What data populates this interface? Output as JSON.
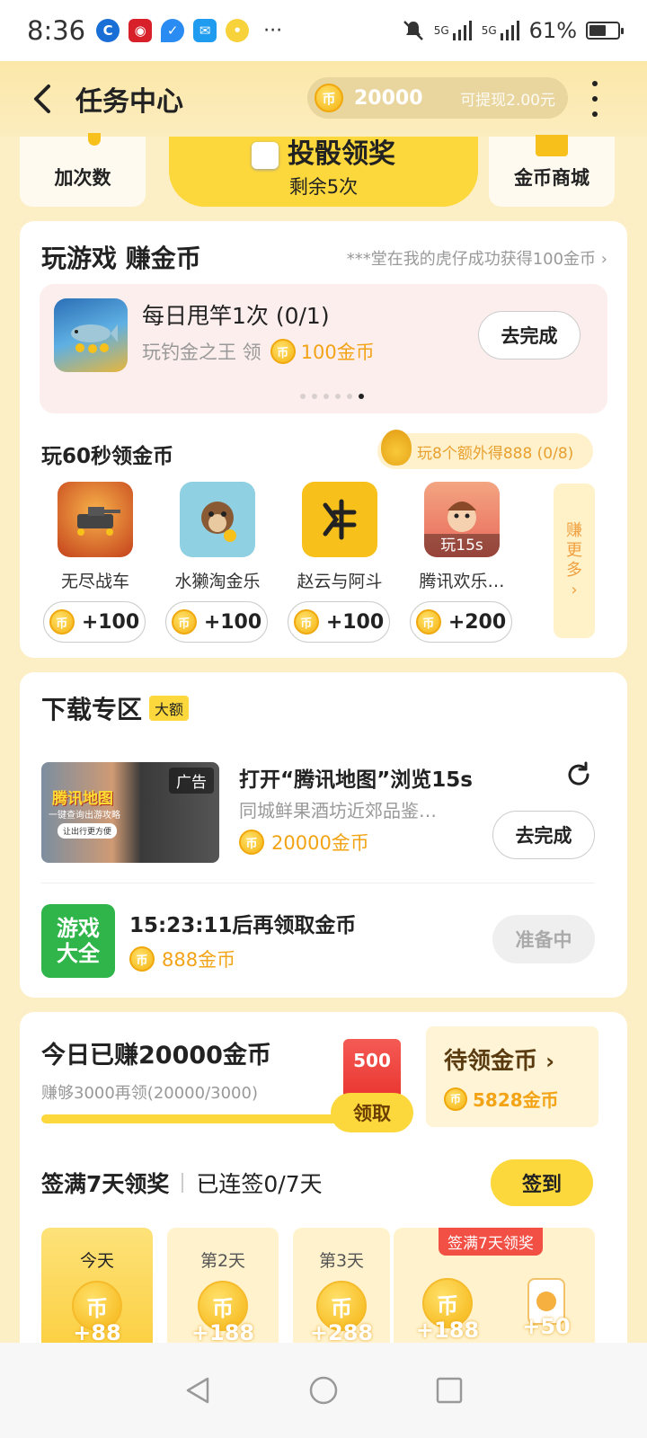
{
  "status_bar": {
    "time": "8:36",
    "more": "···",
    "network": "5G",
    "network2": "5G",
    "battery": "61%"
  },
  "header": {
    "title": "任务中心",
    "coin_balance": "20000",
    "withdraw_text": "可提现2.00元"
  },
  "top_cards": {
    "left_label": "加次数",
    "center_title": "投骰领奖",
    "center_sub": "剩余5次",
    "right_label": "金币商城"
  },
  "play_games": {
    "title": "玩游戏 赚金币",
    "ticker": "***堂在我的虎仔成功获得100金币",
    "task": {
      "name": "每日甩竿1次 (0/1)",
      "game": "玩钓金之王 领",
      "reward": "100金币",
      "button": "去完成"
    },
    "carousel_count": 6,
    "carousel_active": 5
  },
  "sixty_sec": {
    "title": "玩60秒领金币",
    "bonus": "玩8个额外得888 (0/8)",
    "games": [
      {
        "name": "无尽战车",
        "reward": "+100",
        "color": "#e5652a"
      },
      {
        "name": "水獭淘金乐",
        "reward": "+100",
        "color": "#7dc6d8"
      },
      {
        "name": "赵云与阿斗",
        "reward": "+100",
        "color": "#f7c01a"
      },
      {
        "name": "腾讯欢乐…",
        "reward": "+200",
        "color": "#f08a6a",
        "overlay": "玩15s"
      }
    ],
    "more": [
      "赚",
      "更",
      "多",
      "›"
    ]
  },
  "download": {
    "title": "下载专区",
    "tag": "大额",
    "ad": {
      "badge": "广告",
      "title": "打开“腾讯地图”浏览15s",
      "desc": "同城鲜果酒坊近郊品鉴…",
      "reward": "20000金币",
      "button": "去完成",
      "thumb_text": "腾讯地图",
      "thumb_sub": "一键查询出游攻略",
      "thumb_btn": "让出行更方便"
    },
    "next": {
      "icon_text1": "游戏",
      "icon_text2": "大全",
      "title": "15:23:11后再领取金币",
      "reward": "888金币",
      "button": "准备中"
    }
  },
  "earned": {
    "title": "今日已赚20000金币",
    "sub": "赚够3000再领(20000/3000)",
    "progress": 1.0,
    "box_value": "500",
    "claim": "领取",
    "pending_title": "待领金币",
    "pending_value": "5828金币"
  },
  "checkin": {
    "title": "签满7天领奖",
    "status": "已连签0/7天",
    "button": "签到",
    "banner": "签满7天领奖",
    "days": [
      {
        "label": "今天",
        "value": "+88"
      },
      {
        "label": "第2天",
        "value": "+188"
      },
      {
        "label": "第3天",
        "value": "+288"
      },
      {
        "label": "",
        "value": "+188"
      },
      {
        "label": "",
        "value": "+50"
      }
    ]
  },
  "coin_symbol": "币"
}
